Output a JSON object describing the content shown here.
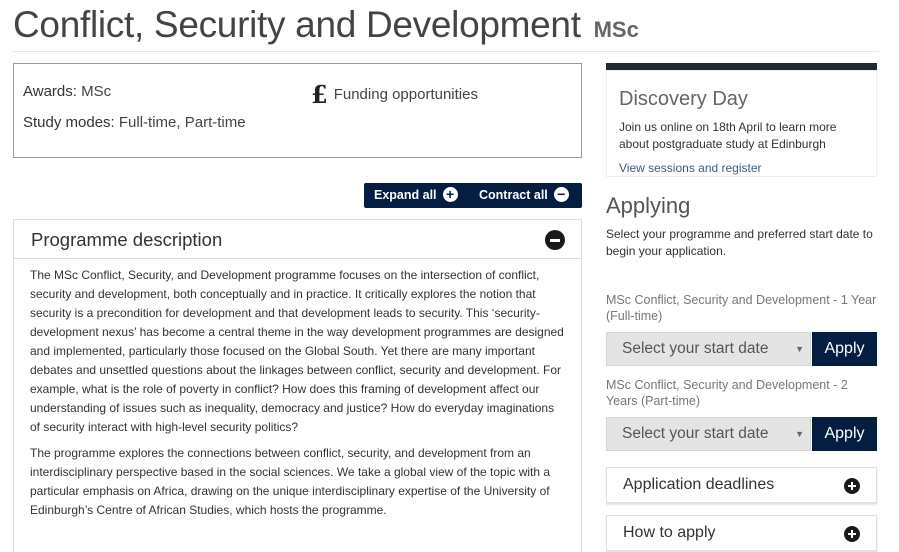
{
  "header": {
    "title": "Conflict, Security and Development",
    "degree": "MSc"
  },
  "summary": {
    "awards_label": "Awards:",
    "awards_value": "MSc",
    "study_modes_label": "Study modes:",
    "study_modes_value": "Full-time, Part-time",
    "funding_icon": "£",
    "funding_label": "Funding opportunities"
  },
  "controls": {
    "expand_all": "Expand all",
    "contract_all": "Contract all"
  },
  "programme_description": {
    "title": "Programme description",
    "paragraphs": [
      "The MSc Conflict, Security, and Development programme focuses on the intersection of conflict, security and development, both conceptually and in practice. It critically explores the notion that security is a precondition for development and that development leads to security. This ‘security-development nexus’ has become a central theme in the way development programmes are designed and implemented, particularly those focused on the Global South. Yet there are many important debates and unsettled questions about the linkages between conflict, security and development. For example, what is the role of poverty in conflict? How does this framing of development affect our understanding of issues such as inequality, democracy and justice? How do everyday imaginations of security interact with high-level security politics?",
      "The programme explores the connections between conflict, security, and development from an interdisciplinary perspective based in the social sciences. We take a global view of the topic with a particular emphasis on Africa, drawing on the unique interdisciplinary expertise of the University of Edinburgh’s Centre of African Studies, which hosts the programme."
    ]
  },
  "discovery_day": {
    "title": "Discovery Day",
    "text": "Join us online on 18th April to learn more about postgraduate study at Edinburgh",
    "link": "View sessions and register"
  },
  "applying": {
    "title": "Applying",
    "intro": "Select your programme and preferred start date to begin your application.",
    "options": [
      {
        "programme": "MSc Conflict, Security and Development - 1 Year (Full-time)",
        "select_placeholder": "Select your start date",
        "apply_label": "Apply"
      },
      {
        "programme": "MSc Conflict, Security and Development - 2 Years (Part-time)",
        "select_placeholder": "Select your start date",
        "apply_label": "Apply"
      }
    ]
  },
  "side_accordions": {
    "deadlines": "Application deadlines",
    "how_to_apply": "How to apply"
  },
  "colors": {
    "brand_navy": "#041e42",
    "link_blue": "#3e5c7e"
  }
}
